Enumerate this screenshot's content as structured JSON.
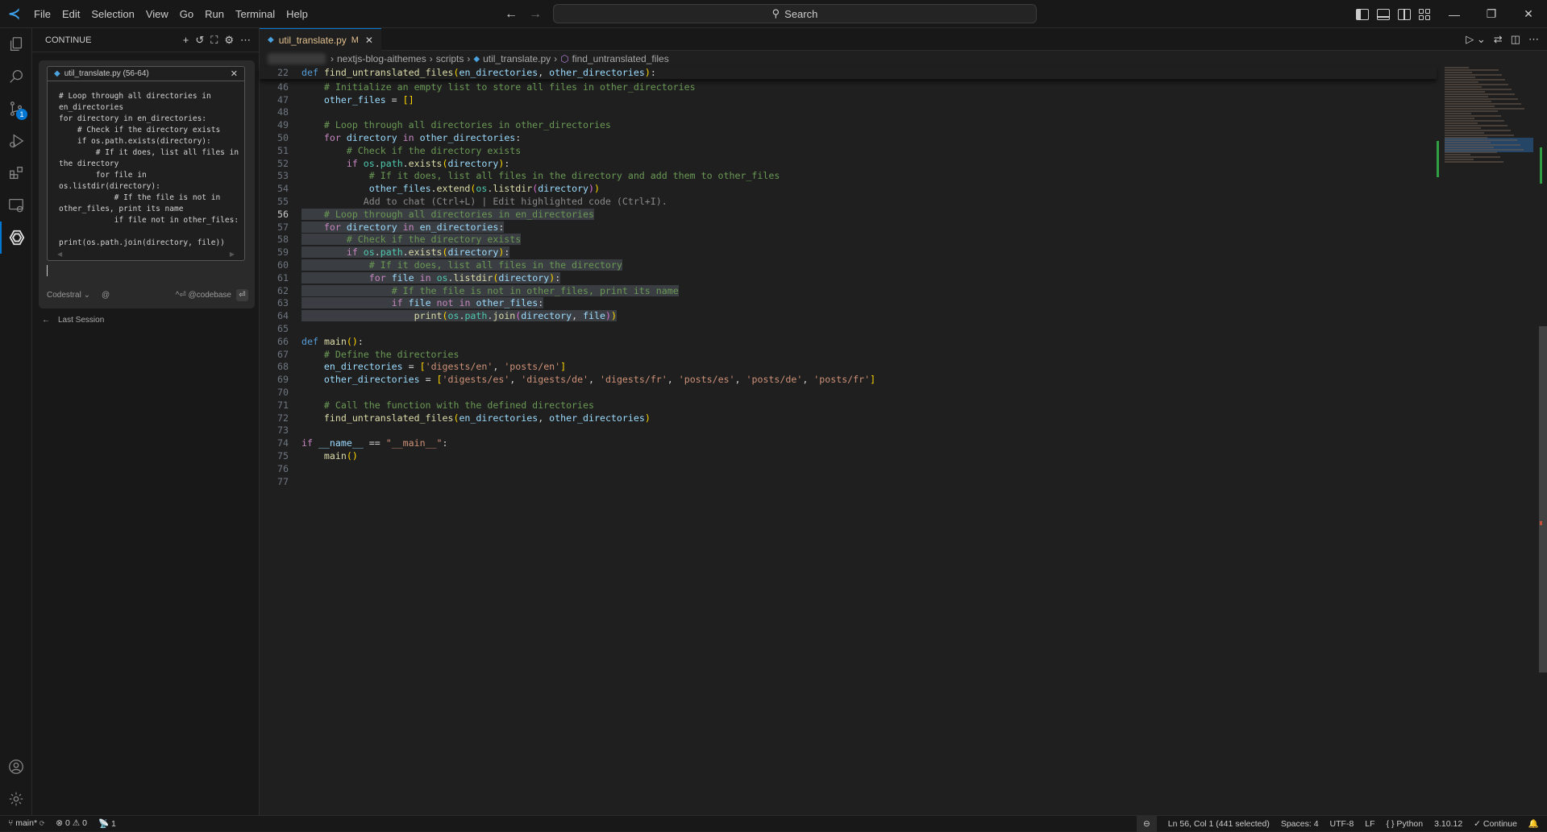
{
  "menu": [
    "File",
    "Edit",
    "Selection",
    "View",
    "Go",
    "Run",
    "Terminal",
    "Help"
  ],
  "search": {
    "placeholder": "Search"
  },
  "sidebar": {
    "title": "CONTINUE",
    "context_card": {
      "title": "util_translate.py (56-64)",
      "code": "# Loop through all directories in\nen_directories\nfor directory in en_directories:\n    # Check if the directory exists\n    if os.path.exists(directory):\n        # If it does, list all files in\nthe directory\n        for file in\nos.listdir(directory):\n            # If the file is not in\nother_files, print its name\n            if file not in other_files:\n\nprint(os.path.join(directory, file))"
    },
    "model": "Codestral",
    "codebase_hint": "^⏎ @codebase",
    "last_session": "Last Session"
  },
  "activity": {
    "scm_badge": "1"
  },
  "tab": {
    "filename": "util_translate.py",
    "status": "M"
  },
  "breadcrumb": [
    "nextjs-blog-aithemes",
    "scripts",
    "util_translate.py",
    "find_untranslated_files"
  ],
  "editor": {
    "current_line": 56,
    "inline_hint": "Add to chat (Ctrl+L) | Edit highlighted code (Ctrl+I)."
  },
  "code_lines": [
    {
      "n": "22",
      "text": "def find_untranslated_files(en_directories, other_directories):"
    },
    {
      "n": "46",
      "text": "    # Initialize an empty list to store all files in other_directories"
    },
    {
      "n": "47",
      "text": "    other_files = []"
    },
    {
      "n": "48",
      "text": ""
    },
    {
      "n": "49",
      "text": "    # Loop through all directories in other_directories"
    },
    {
      "n": "50",
      "text": "    for directory in other_directories:"
    },
    {
      "n": "51",
      "text": "        # Check if the directory exists"
    },
    {
      "n": "52",
      "text": "        if os.path.exists(directory):"
    },
    {
      "n": "53",
      "text": "            # If it does, list all files in the directory and add them to other_files"
    },
    {
      "n": "54",
      "text": "            other_files.extend(os.listdir(directory))"
    },
    {
      "n": "55",
      "text": "           Add to chat (Ctrl+L) | Edit highlighted code (Ctrl+I)."
    },
    {
      "n": "56",
      "text": "    # Loop through all directories in en_directories"
    },
    {
      "n": "57",
      "text": "    for directory in en_directories:"
    },
    {
      "n": "58",
      "text": "        # Check if the directory exists"
    },
    {
      "n": "59",
      "text": "        if os.path.exists(directory):"
    },
    {
      "n": "60",
      "text": "            # If it does, list all files in the directory"
    },
    {
      "n": "61",
      "text": "            for file in os.listdir(directory):"
    },
    {
      "n": "62",
      "text": "                # If the file is not in other_files, print its name"
    },
    {
      "n": "63",
      "text": "                if file not in other_files:"
    },
    {
      "n": "64",
      "text": "                    print(os.path.join(directory, file))"
    },
    {
      "n": "65",
      "text": ""
    },
    {
      "n": "66",
      "text": "def main():"
    },
    {
      "n": "67",
      "text": "    # Define the directories"
    },
    {
      "n": "68",
      "text": "    en_directories = ['digests/en', 'posts/en']"
    },
    {
      "n": "69",
      "text": "    other_directories = ['digests/es', 'digests/de', 'digests/fr', 'posts/es', 'posts/de', 'posts/fr']"
    },
    {
      "n": "70",
      "text": ""
    },
    {
      "n": "71",
      "text": "    # Call the function with the defined directories"
    },
    {
      "n": "72",
      "text": "    find_untranslated_files(en_directories, other_directories)"
    },
    {
      "n": "73",
      "text": ""
    },
    {
      "n": "74",
      "text": "if __name__ == \"__main__\":"
    },
    {
      "n": "75",
      "text": "    main()"
    },
    {
      "n": "76",
      "text": ""
    },
    {
      "n": "77",
      "text": ""
    }
  ],
  "status": {
    "branch": "main*",
    "errors": "0",
    "warnings": "0",
    "ports": "1",
    "cursor": "Ln 56, Col 1 (441 selected)",
    "indent": "Spaces: 4",
    "encoding": "UTF-8",
    "eol": "LF",
    "language": "Python",
    "interpreter": "3.10.12",
    "continue": "✓ Continue"
  }
}
